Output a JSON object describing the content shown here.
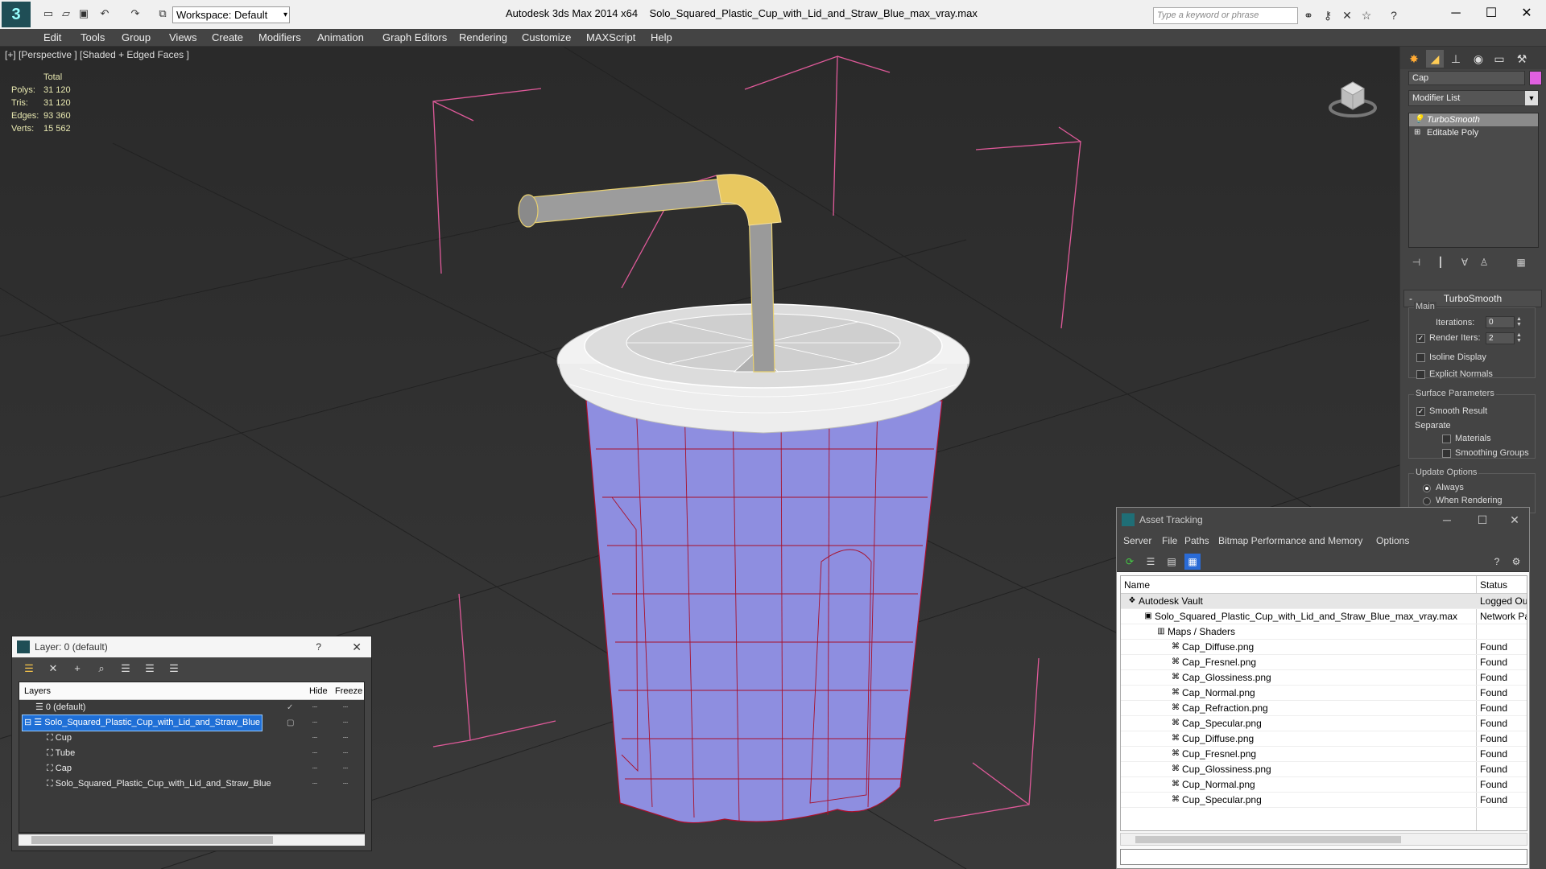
{
  "window": {
    "app_title": "Autodesk 3ds Max  2014 x64",
    "file_title": "Solo_Squared_Plastic_Cup_with_Lid_and_Straw_Blue_max_vray.max",
    "workspace": "Workspace: Default",
    "search_placeholder": "Type a keyword or phrase"
  },
  "menu": [
    "Edit",
    "Tools",
    "Group",
    "Views",
    "Create",
    "Modifiers",
    "Animation",
    "Graph Editors",
    "Rendering",
    "Customize",
    "MAXScript",
    "Help"
  ],
  "viewport": {
    "label": "[+] [Perspective ] [Shaded + Edged Faces ]",
    "stats": {
      "header": "Total",
      "rows": [
        {
          "label": "Polys:",
          "value": "31 120"
        },
        {
          "label": "Tris:",
          "value": "31 120"
        },
        {
          "label": "Edges:",
          "value": "93 360"
        },
        {
          "label": "Verts:",
          "value": "15 562"
        }
      ]
    }
  },
  "command_panel": {
    "object_name": "Cap",
    "object_color": "#e060e0",
    "modifier_list": "Modifier List",
    "stack": [
      "TurboSmooth",
      "Editable Poly"
    ],
    "rollout_title": "TurboSmooth",
    "main_group": "Main",
    "iterations_label": "Iterations:",
    "iterations_value": "0",
    "render_iters_label": "Render Iters:",
    "render_iters_value": "2",
    "isoline_label": "Isoline Display",
    "explicit_normals_label": "Explicit Normals",
    "surface_group": "Surface Parameters",
    "smooth_result_label": "Smooth Result",
    "separate_label": "Separate",
    "materials_label": "Materials",
    "smoothing_groups_label": "Smoothing Groups",
    "update_group": "Update Options",
    "always_label": "Always",
    "when_rendering_label": "When Rendering"
  },
  "layer_window": {
    "title": "Layer: 0 (default)",
    "help": "?",
    "columns": {
      "layers": "Layers",
      "hide": "Hide",
      "freeze": "Freeze"
    },
    "rows": [
      {
        "label": "0 (default)",
        "level": 0
      },
      {
        "label": "Solo_Squared_Plastic_Cup_with_Lid_and_Straw_Blue",
        "level": 0,
        "selected": true
      },
      {
        "label": "Cup",
        "level": 1
      },
      {
        "label": "Tube",
        "level": 1
      },
      {
        "label": "Cap",
        "level": 1
      },
      {
        "label": "Solo_Squared_Plastic_Cup_with_Lid_and_Straw_Blue",
        "level": 1
      }
    ]
  },
  "asset_window": {
    "title": "Asset Tracking",
    "menu": [
      "Server",
      "File",
      "Paths",
      "Bitmap Performance and Memory",
      "Options"
    ],
    "columns": {
      "name": "Name",
      "status": "Status"
    },
    "rows": [
      {
        "name": "Autodesk Vault",
        "status": "Logged Ou",
        "level": 0
      },
      {
        "name": "Solo_Squared_Plastic_Cup_with_Lid_and_Straw_Blue_max_vray.max",
        "status": "Network Pa",
        "level": 1
      },
      {
        "name": "Maps / Shaders",
        "status": "",
        "level": 2
      },
      {
        "name": "Cap_Diffuse.png",
        "status": "Found",
        "level": 3
      },
      {
        "name": "Cap_Fresnel.png",
        "status": "Found",
        "level": 3
      },
      {
        "name": "Cap_Glossiness.png",
        "status": "Found",
        "level": 3
      },
      {
        "name": "Cap_Normal.png",
        "status": "Found",
        "level": 3
      },
      {
        "name": "Cap_Refraction.png",
        "status": "Found",
        "level": 3
      },
      {
        "name": "Cap_Specular.png",
        "status": "Found",
        "level": 3
      },
      {
        "name": "Cup_Diffuse.png",
        "status": "Found",
        "level": 3
      },
      {
        "name": "Cup_Fresnel.png",
        "status": "Found",
        "level": 3
      },
      {
        "name": "Cup_Glossiness.png",
        "status": "Found",
        "level": 3
      },
      {
        "name": "Cup_Normal.png",
        "status": "Found",
        "level": 3
      },
      {
        "name": "Cup_Specular.png",
        "status": "Found",
        "level": 3
      }
    ]
  }
}
